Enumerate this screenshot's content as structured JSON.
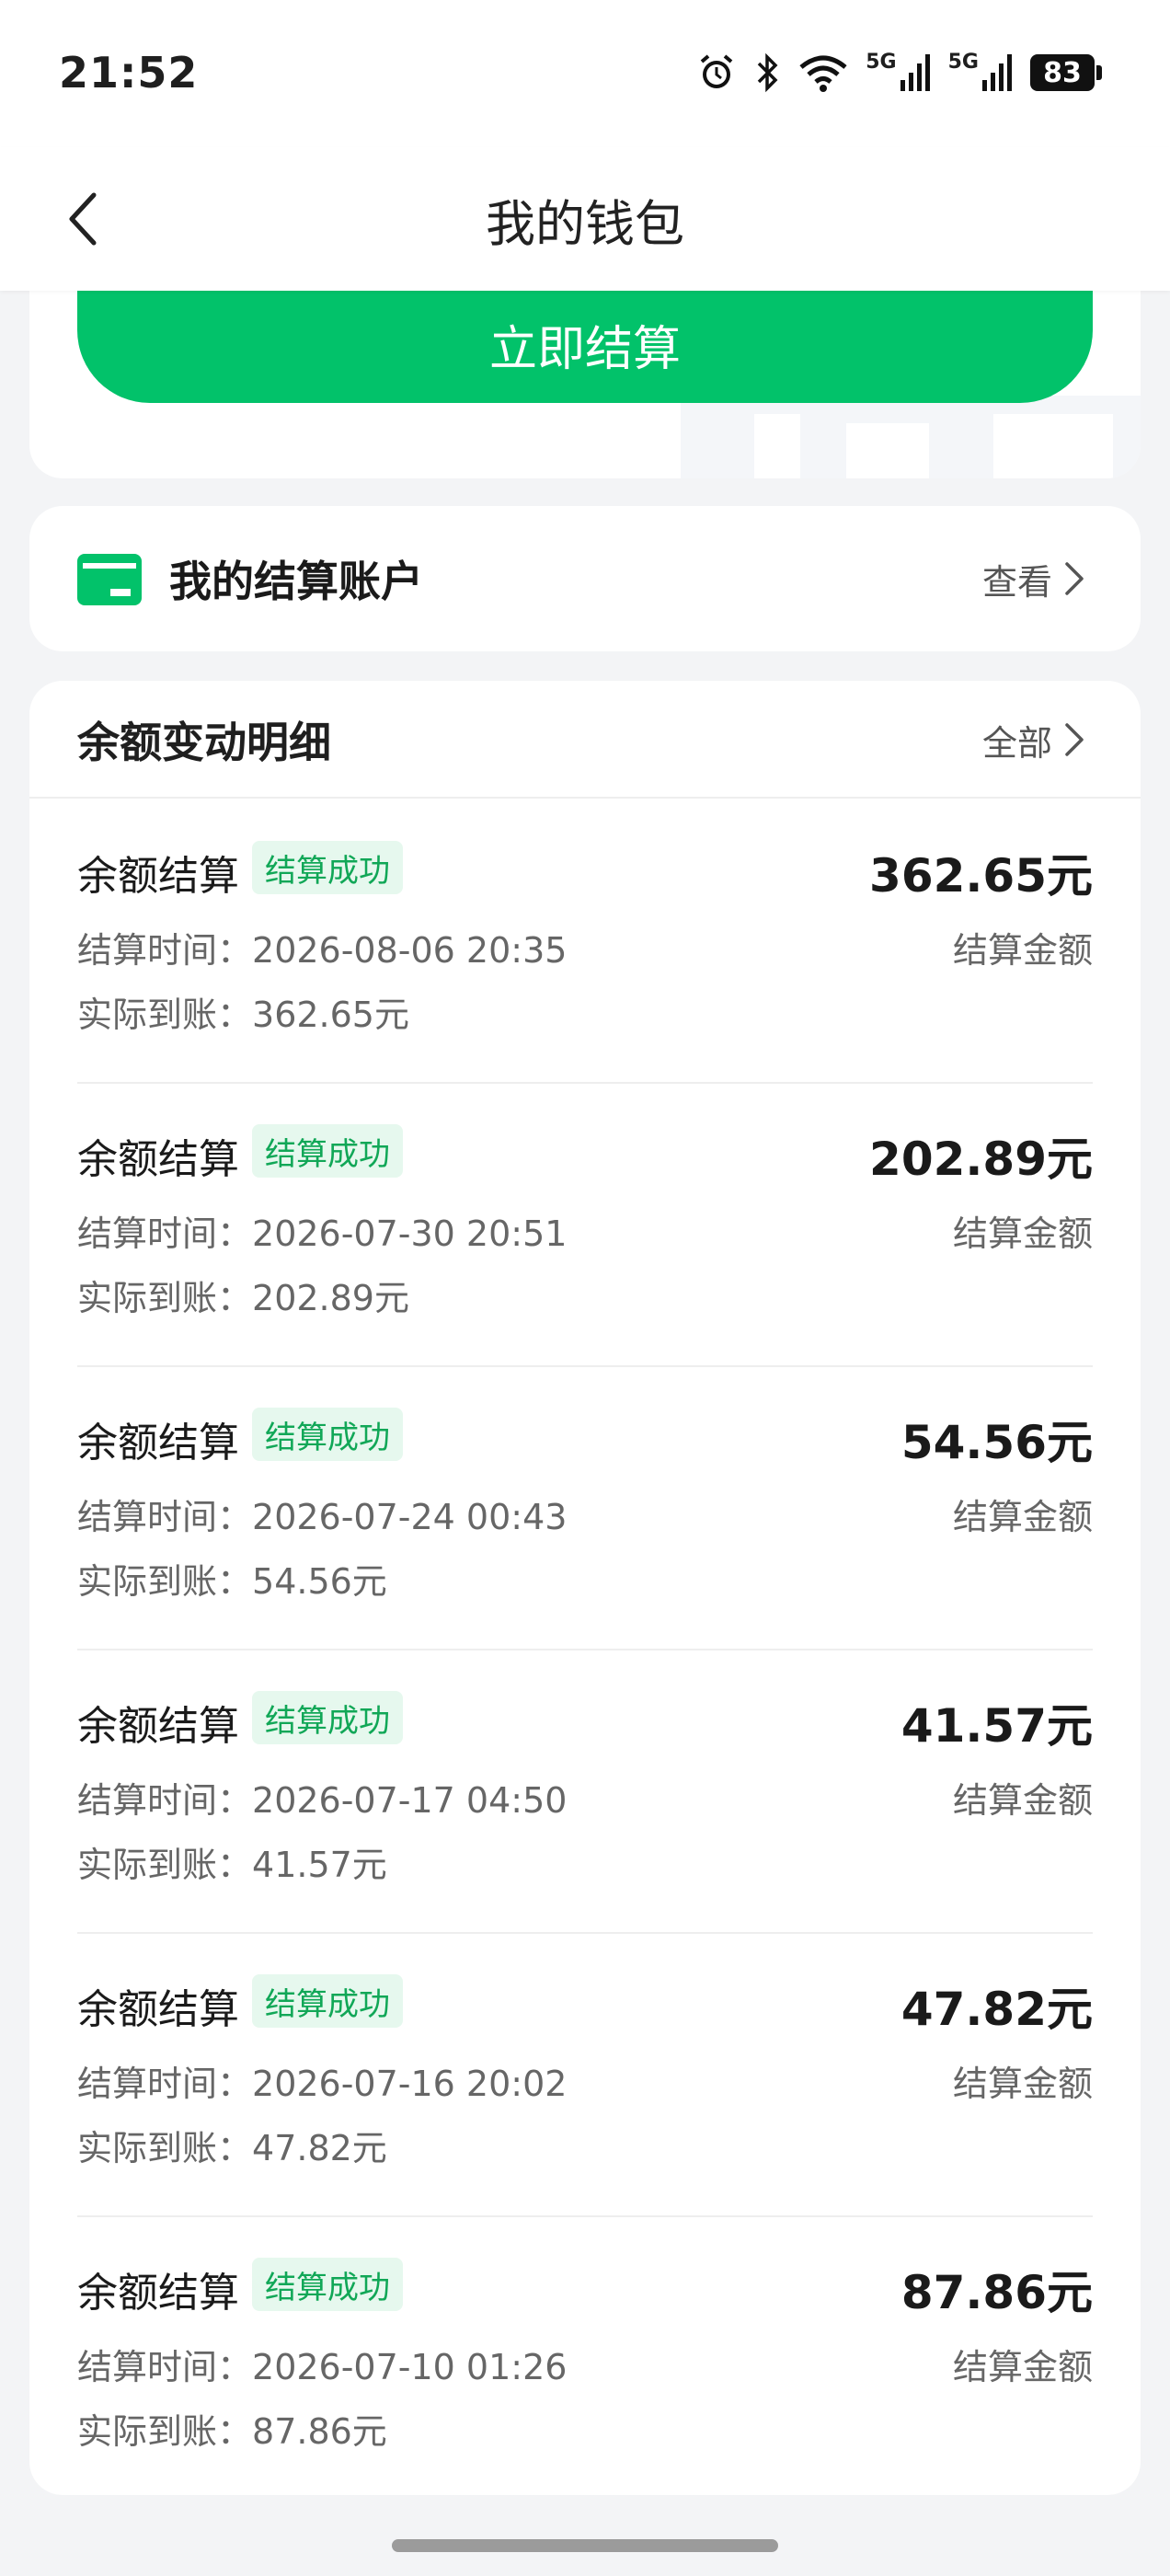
{
  "status": {
    "time": "21:52",
    "net1": "5G",
    "net2": "5G",
    "battery": "83"
  },
  "nav": {
    "title": "我的钱包"
  },
  "actions": {
    "settle_now": "立即结算"
  },
  "account": {
    "title": "我的结算账户",
    "view_label": "查看"
  },
  "details": {
    "title": "余额变动明细",
    "all_label": "全部",
    "records": [
      {
        "type": "余额结算",
        "status": "结算成功",
        "time_label": "结算时间：",
        "time": "2026-08-06 20:35",
        "received_label": "实际到账：",
        "received": "362.65元",
        "amount": "362.65元",
        "amount_label": "结算金额"
      },
      {
        "type": "余额结算",
        "status": "结算成功",
        "time_label": "结算时间：",
        "time": "2026-07-30 20:51",
        "received_label": "实际到账：",
        "received": "202.89元",
        "amount": "202.89元",
        "amount_label": "结算金额"
      },
      {
        "type": "余额结算",
        "status": "结算成功",
        "time_label": "结算时间：",
        "time": "2026-07-24 00:43",
        "received_label": "实际到账：",
        "received": "54.56元",
        "amount": "54.56元",
        "amount_label": "结算金额"
      },
      {
        "type": "余额结算",
        "status": "结算成功",
        "time_label": "结算时间：",
        "time": "2026-07-17 04:50",
        "received_label": "实际到账：",
        "received": "41.57元",
        "amount": "41.57元",
        "amount_label": "结算金额"
      },
      {
        "type": "余额结算",
        "status": "结算成功",
        "time_label": "结算时间：",
        "time": "2026-07-16 20:02",
        "received_label": "实际到账：",
        "received": "47.82元",
        "amount": "47.82元",
        "amount_label": "结算金额"
      },
      {
        "type": "余额结算",
        "status": "结算成功",
        "time_label": "结算时间：",
        "time": "2026-07-10 01:26",
        "received_label": "实际到账：",
        "received": "87.86元",
        "amount": "87.86元",
        "amount_label": "结算金额"
      }
    ]
  },
  "colors": {
    "accent": "#02c26a",
    "badge_bg": "#e6f8ee",
    "badge_text": "#11a757"
  }
}
